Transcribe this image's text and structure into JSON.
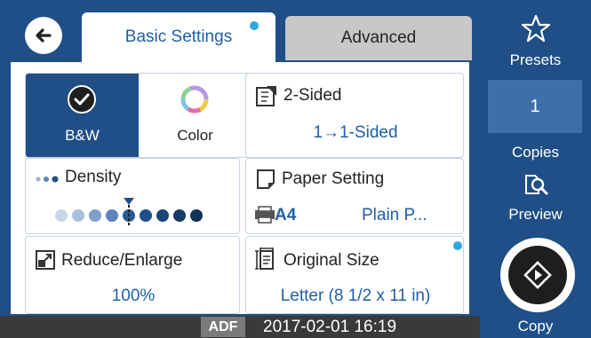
{
  "tabs": {
    "basic": "Basic Settings",
    "advanced": "Advanced"
  },
  "color_mode": {
    "bw_label": "B&W",
    "color_label": "Color",
    "selected": "B&W"
  },
  "two_sided": {
    "title": "2-Sided",
    "value": "1→1-Sided"
  },
  "density": {
    "title": "Density",
    "level": 4,
    "levels": 9
  },
  "paper": {
    "title": "Paper Setting",
    "size": "A4",
    "type": "Plain P..."
  },
  "reduce": {
    "title": "Reduce/Enlarge",
    "value": "100%"
  },
  "original": {
    "title": "Original Size",
    "value": "Letter (8 1/2 x 11 in)"
  },
  "status": {
    "adf": "ADF",
    "datetime": "2017-02-01 16:19"
  },
  "sidebar": {
    "presets": "Presets",
    "copies_value": "1",
    "copies_label": "Copies",
    "preview": "Preview",
    "copy": "Copy"
  },
  "colors": {
    "brand_blue": "#1f4f86",
    "accent_dot": "#2fa6e3"
  }
}
